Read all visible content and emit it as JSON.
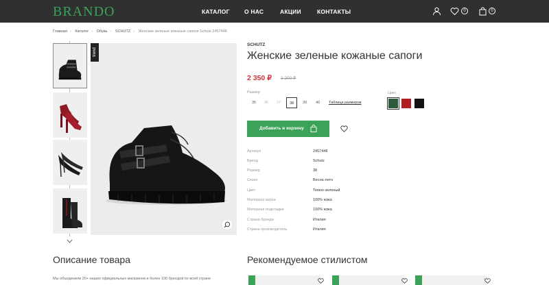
{
  "header": {
    "logo": "BRANDO",
    "nav": [
      "КАТАЛОГ",
      "О НАС",
      "АКЦИИ",
      "КОНТАКТЫ"
    ],
    "fav_count": "0",
    "cart_count": "0"
  },
  "breadcrumbs": [
    "Главная",
    "Каталог",
    "Обувь",
    "SCHUTZ",
    "Женские зеленые кожаные сапоги Schutz 2457448"
  ],
  "product": {
    "trend_label": "trend",
    "brand": "SCHUTZ",
    "title": "Женские зеленые кожаные сапоги",
    "price": "2 350 ₽",
    "old_price": "3 200 ₽",
    "size_label": "Размер",
    "sizes": [
      "35",
      "36",
      "37",
      "38",
      "39",
      "40"
    ],
    "selected_size": "38",
    "size_table_link": "Таблица размеров",
    "color_label": "Цвет",
    "colors": [
      "#2d5a3a",
      "#b01e22",
      "#111111"
    ],
    "add_to_cart": "Добавить в корзину",
    "specs": [
      {
        "key": "Артикул",
        "value": "2457448"
      },
      {
        "key": "Бренд",
        "value": "Schutz"
      },
      {
        "key": "Размер",
        "value": "38"
      },
      {
        "key": "Сезон",
        "value": "Весна-лето"
      },
      {
        "key": "Цвет",
        "value": "Темно-зеленый"
      },
      {
        "key": "Материал верха",
        "value": "100% кожа"
      },
      {
        "key": "Материал подкладки",
        "value": "100% кожа"
      },
      {
        "key": "Страна бренда",
        "value": "Италия"
      },
      {
        "key": "Страна производитель",
        "value": "Италия"
      }
    ]
  },
  "sections": {
    "description_title": "Описание товара",
    "description_text": "Мы объединили 20+ наших официальных магазинов и более 100 брендов по всей стране",
    "recommended_title": "Рекомендуемое стилистом"
  }
}
